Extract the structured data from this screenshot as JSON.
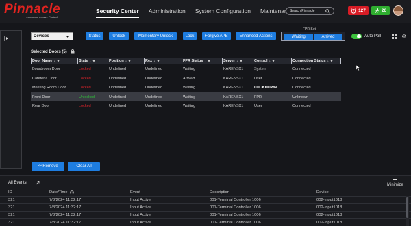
{
  "brand": {
    "name": "Pinnacle",
    "tagline": "Advanced Access Control"
  },
  "nav": [
    {
      "label": "Security Center",
      "active": true
    },
    {
      "label": "Administration",
      "active": false
    },
    {
      "label": "System Configuration",
      "active": false
    },
    {
      "label": "Maintenance",
      "active": false
    }
  ],
  "search": {
    "placeholder": "Search Pinnacle"
  },
  "alerts": {
    "alarm_count": "127",
    "event_count": "26"
  },
  "toolbar": {
    "device_select": "Devices",
    "buttons": [
      "Status",
      "Unlock",
      "Momentary Unlock",
      "Lock",
      "Forgive APB",
      "Enhanced Actions"
    ],
    "fpr_set_label": "FPR Set",
    "fpr_waiting": "Waiting",
    "fpr_arrived": "Arrived",
    "auto_poll_label": "Auto Poll",
    "auto_poll_on": true
  },
  "selected": {
    "title": "Selected Doors (5)"
  },
  "table": {
    "headers": [
      "Door Name",
      "State",
      "Position",
      "Rex",
      "FPR Status",
      "Server",
      "Control",
      "Connection Status"
    ],
    "rows": [
      [
        "Boardroom Door",
        "Locked",
        "Undefined",
        "Undefined",
        "Waiting",
        "KARENSX1",
        "System",
        "Connected"
      ],
      [
        "Cafeteria Door",
        "Locked",
        "Undefined",
        "Undefined",
        "Arrived",
        "KARENSX1",
        "User",
        "Connected"
      ],
      [
        "Meeting Room Door",
        "Locked",
        "Undefined",
        "Undefined",
        "Waiting",
        "KARENSX1",
        "LOCKDOWN",
        "Connected"
      ],
      [
        "Front Door",
        "Unlocked",
        "Undefined",
        "Undefined",
        "Waiting",
        "KARENSX1",
        "FPR",
        "Unknown"
      ],
      [
        "Rear Door",
        "Locked",
        "Undefined",
        "Undefined",
        "Waiting",
        "KARENSX1",
        "User",
        "Connected"
      ]
    ]
  },
  "actions": {
    "remove": "<<Remove",
    "clear": "Clear All"
  },
  "events": {
    "title": "All Events",
    "minimize": "Minimize",
    "headers": [
      "ID",
      "Date/Time",
      "Event",
      "Description",
      "Device"
    ],
    "rows": [
      [
        "321",
        "7/8/2024 11:32:17",
        "Input Active",
        "001-Terminal Controller 1006",
        "002-Input1018"
      ],
      [
        "321",
        "7/8/2024 11:32:17",
        "Input Active",
        "001-Terminal Controller 1006",
        "002-Input1018"
      ],
      [
        "321",
        "7/8/2024 11:32:17",
        "Input Active",
        "001-Terminal Controller 1006",
        "002-Input1018"
      ],
      [
        "321",
        "7/8/2024 11:32:17",
        "Input Active",
        "001-Terminal Controller 1006",
        "002-Input1018"
      ]
    ]
  },
  "colors": {
    "accent": "#1e7de0",
    "brand_red": "#e0231f",
    "alarm_red": "#d81c25",
    "ok_green": "#2fae2f",
    "locked": "#d9242b",
    "unlocked": "#2fbf3a"
  }
}
